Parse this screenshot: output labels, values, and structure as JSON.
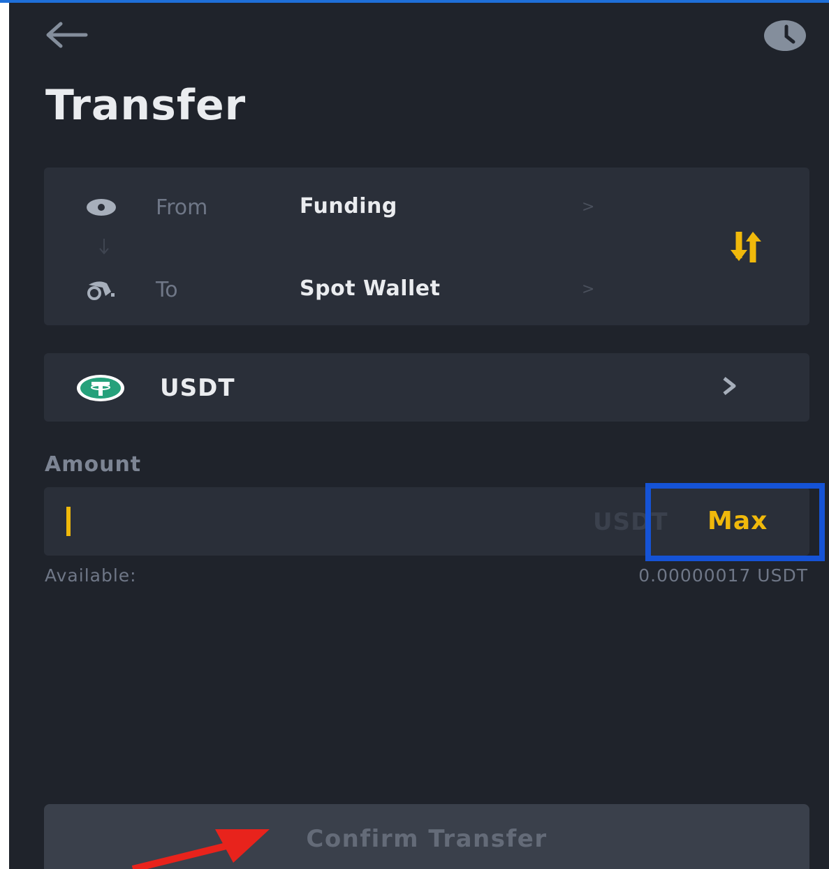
{
  "header": {
    "title": "Transfer",
    "back_icon": "arrow-left-icon",
    "history_icon": "clock-icon"
  },
  "transfer": {
    "from_label": "From",
    "from_value": "Funding",
    "to_label": "To",
    "to_value": "Spot Wallet",
    "chevron": ">",
    "swap_icon": "swap-vertical-icon"
  },
  "coin": {
    "name": "USDT",
    "icon": "tether-icon"
  },
  "amount": {
    "label": "Amount",
    "unit": "USDT",
    "max_label": "Max"
  },
  "available": {
    "label": "Available:",
    "value": "0.00000017 USDT"
  },
  "confirm": {
    "label": "Confirm Transfer"
  },
  "colors": {
    "background": "#1f232b",
    "card": "#2a2f39",
    "accent": "#f0b90b",
    "annotation_box": "#1553d6",
    "annotation_arrow": "#e8231c"
  }
}
